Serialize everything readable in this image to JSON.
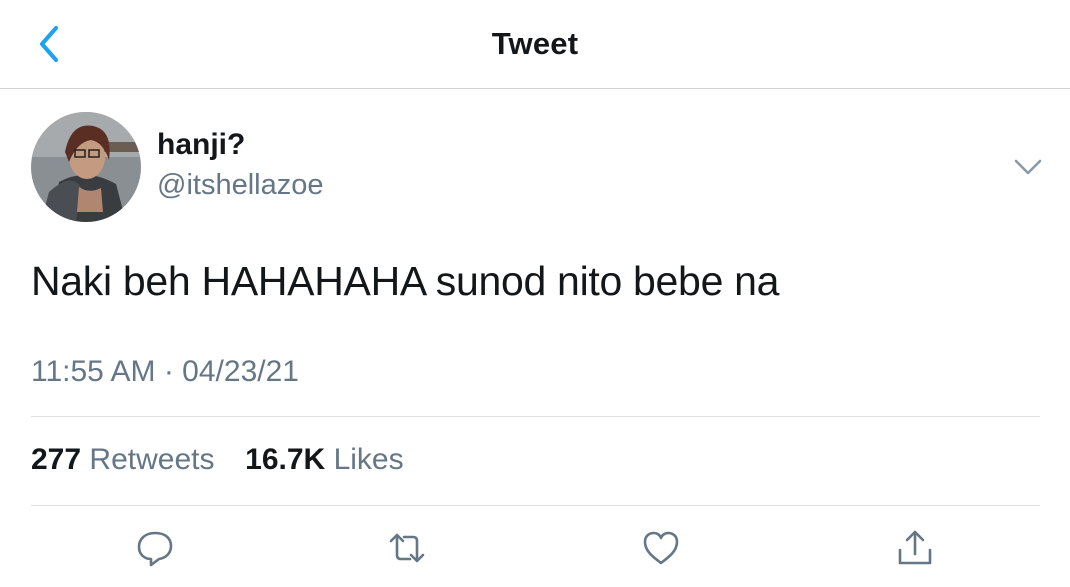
{
  "header": {
    "title": "Tweet",
    "back_icon": "chevron-left-icon",
    "accent_color": "#1da1f2"
  },
  "tweet": {
    "display_name": "hanji?",
    "handle": "@itshellazoe",
    "text": "Naki beh HAHAHAHA sunod nito bebe na",
    "timestamp": "11:55 AM · 04/23/21",
    "retweets_count": "277",
    "retweets_label": "Retweets",
    "likes_count": "16.7K",
    "likes_label": "Likes"
  },
  "actions": [
    {
      "icon": "reply-icon"
    },
    {
      "icon": "retweet-icon"
    },
    {
      "icon": "like-icon"
    },
    {
      "icon": "share-icon"
    }
  ],
  "colors": {
    "text_primary": "#14171a",
    "text_secondary": "#657786",
    "divider": "#dde1e4"
  }
}
